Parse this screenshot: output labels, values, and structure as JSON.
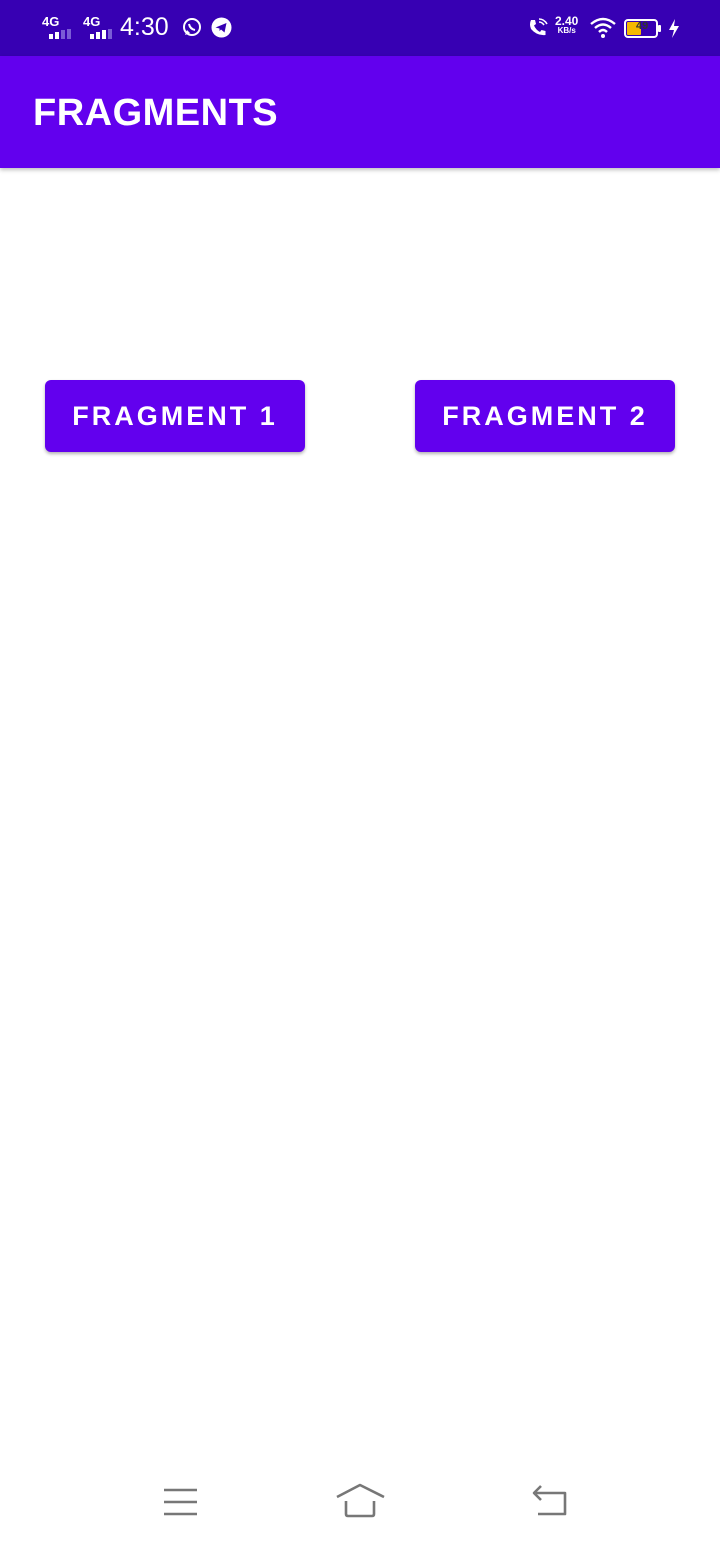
{
  "status_bar": {
    "sim1_network": "4G",
    "sim2_network": "4G",
    "time": "4:30",
    "left_icons": [
      "whatsapp-icon",
      "telegram-icon"
    ],
    "data_speed": "2.40",
    "data_speed_unit": "KB/s",
    "battery_level": "49",
    "right_icons": [
      "wifi-call-icon",
      "wifi-icon",
      "battery-icon",
      "charging-icon"
    ]
  },
  "app_bar": {
    "title": "FRAGMENTS"
  },
  "buttons": {
    "fragment1_label": "FRAGMENT 1",
    "fragment2_label": "FRAGMENT 2"
  },
  "nav_bar": {
    "icons": [
      "menu-icon",
      "home-icon",
      "back-icon"
    ]
  },
  "colors": {
    "status_bar": "#3700b3",
    "primary": "#6200ee",
    "background": "#ffffff",
    "nav_icon": "#777777",
    "battery_fill": "#f5b800"
  }
}
